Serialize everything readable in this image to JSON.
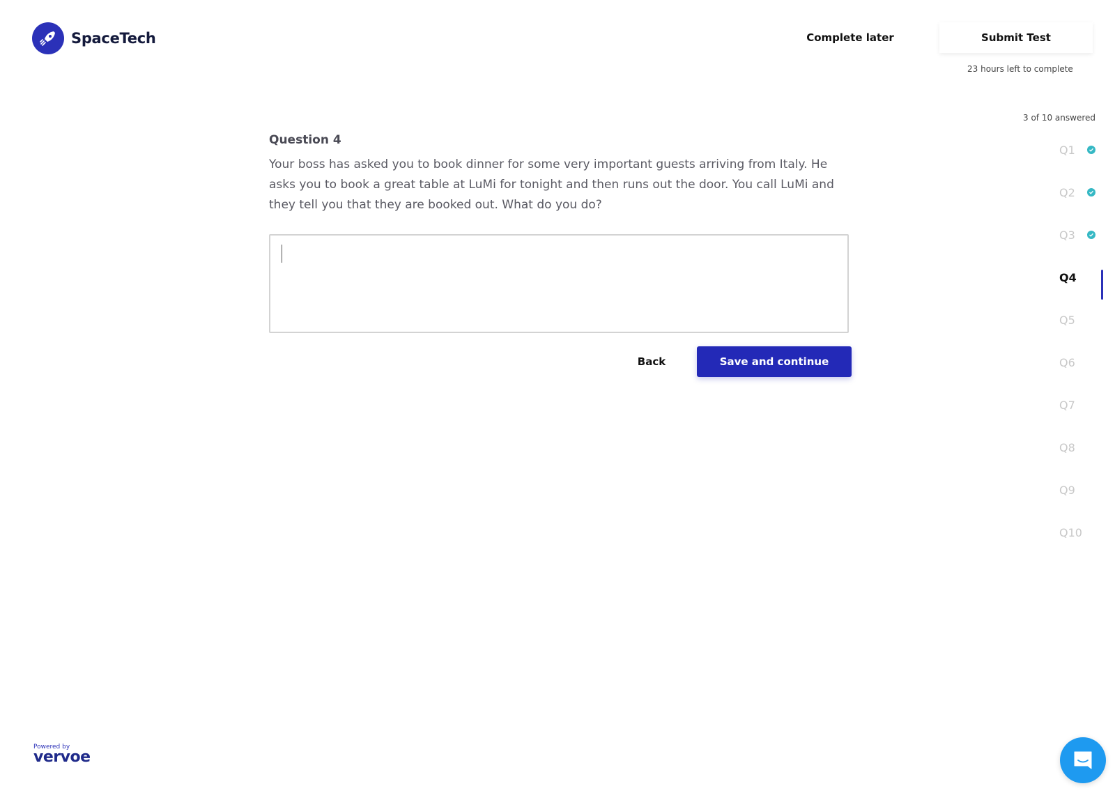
{
  "brand": {
    "name": "SpaceTech",
    "logo_icon": "rocket-icon",
    "accent": "#2b31b8"
  },
  "header": {
    "complete_later": "Complete later",
    "submit_test": "Submit Test",
    "time_left": "23 hours left to complete"
  },
  "progress": {
    "answered_text": "3 of 10 answered",
    "answered": 3,
    "total": 10
  },
  "nav": {
    "items": [
      {
        "label": "Q1",
        "answered": true
      },
      {
        "label": "Q2",
        "answered": true
      },
      {
        "label": "Q3",
        "answered": true
      },
      {
        "label": "Q4",
        "answered": false,
        "active": true
      },
      {
        "label": "Q5",
        "answered": false
      },
      {
        "label": "Q6",
        "answered": false
      },
      {
        "label": "Q7",
        "answered": false
      },
      {
        "label": "Q8",
        "answered": false
      },
      {
        "label": "Q9",
        "answered": false
      },
      {
        "label": "Q10",
        "answered": false
      }
    ],
    "check_color": "#35b8c4"
  },
  "question": {
    "title": "Question 4",
    "text": "Your boss has asked you to book dinner for some very important guests arriving from Italy. He asks you to book a great table at LuMi for tonight and then runs out the door. You call LuMi and they tell you that they are booked out. What do you do?",
    "answer_value": "",
    "answer_placeholder": ""
  },
  "actions": {
    "back": "Back",
    "save_continue": "Save and continue"
  },
  "footer": {
    "powered_by": "Powered by",
    "vendor": "vervoe",
    "chat_icon": "chat-icon"
  }
}
